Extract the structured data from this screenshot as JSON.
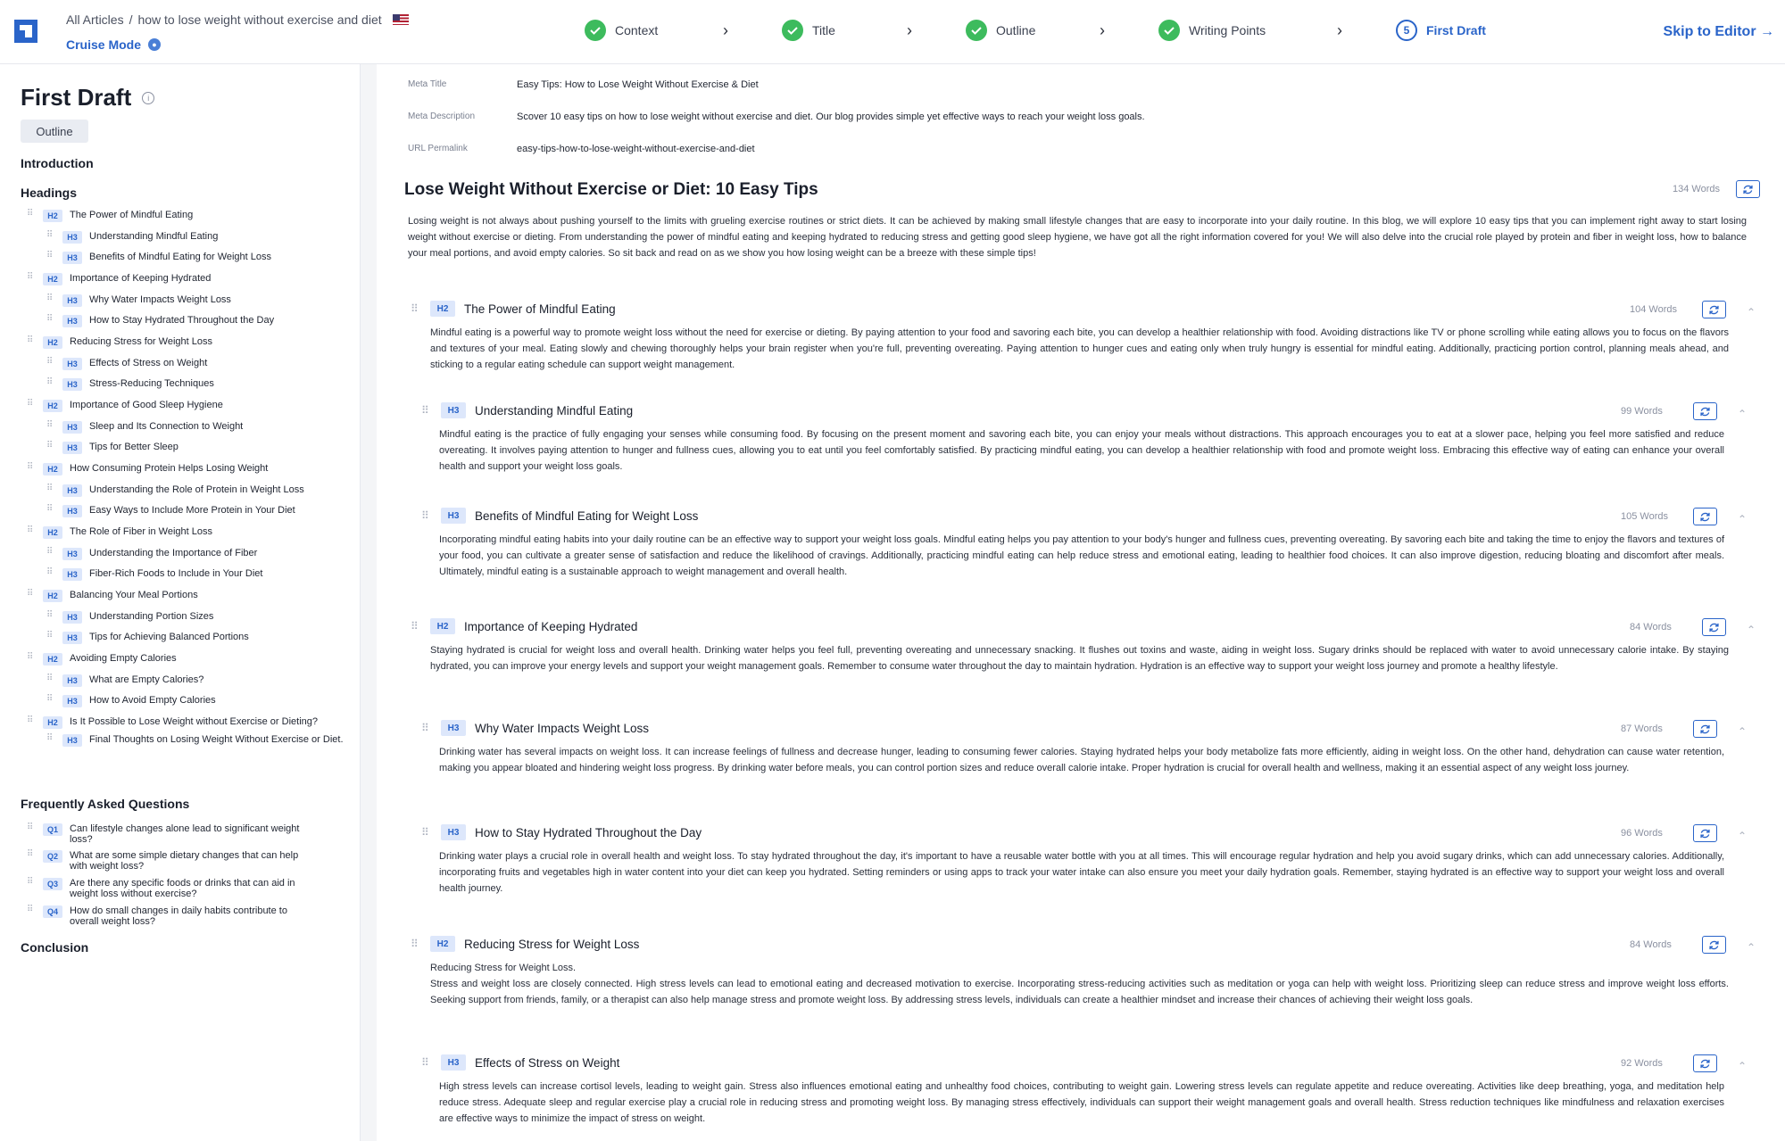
{
  "breadcrumb": {
    "root": "All Articles",
    "separator": "/",
    "current": "how to lose weight without exercise and diet"
  },
  "cruise_mode": "Cruise Mode",
  "steps": [
    {
      "label": "Context",
      "state": "done"
    },
    {
      "label": "Title",
      "state": "done"
    },
    {
      "label": "Outline",
      "state": "done"
    },
    {
      "label": "Writing Points",
      "state": "done"
    },
    {
      "label": "First Draft",
      "state": "active",
      "number": "5"
    }
  ],
  "skip_label": "Skip to Editor →",
  "sidebar": {
    "title": "First Draft",
    "outline_button": "Outline",
    "introduction": "Introduction",
    "headings_label": "Headings",
    "headings": [
      {
        "tag": "H2",
        "text": "The Power of Mindful Eating"
      },
      {
        "tag": "H3",
        "text": "Understanding Mindful Eating"
      },
      {
        "tag": "H3",
        "text": "Benefits of Mindful Eating for Weight Loss"
      },
      {
        "tag": "H2",
        "text": "Importance of Keeping Hydrated"
      },
      {
        "tag": "H3",
        "text": "Why Water Impacts Weight Loss"
      },
      {
        "tag": "H3",
        "text": "How to Stay Hydrated Throughout the Day"
      },
      {
        "tag": "H2",
        "text": "Reducing Stress for Weight Loss"
      },
      {
        "tag": "H3",
        "text": "Effects of Stress on Weight"
      },
      {
        "tag": "H3",
        "text": "Stress-Reducing Techniques"
      },
      {
        "tag": "H2",
        "text": "Importance of Good Sleep Hygiene"
      },
      {
        "tag": "H3",
        "text": "Sleep and Its Connection to Weight"
      },
      {
        "tag": "H3",
        "text": "Tips for Better Sleep"
      },
      {
        "tag": "H2",
        "text": "How Consuming Protein Helps Losing Weight"
      },
      {
        "tag": "H3",
        "text": "Understanding the Role of Protein in Weight Loss"
      },
      {
        "tag": "H3",
        "text": "Easy Ways to Include More Protein in Your Diet"
      },
      {
        "tag": "H2",
        "text": "The Role of Fiber in Weight Loss"
      },
      {
        "tag": "H3",
        "text": "Understanding the Importance of Fiber"
      },
      {
        "tag": "H3",
        "text": "Fiber-Rich Foods to Include in Your Diet"
      },
      {
        "tag": "H2",
        "text": "Balancing Your Meal Portions"
      },
      {
        "tag": "H3",
        "text": "Understanding Portion Sizes"
      },
      {
        "tag": "H3",
        "text": "Tips for Achieving Balanced Portions"
      },
      {
        "tag": "H2",
        "text": "Avoiding Empty Calories"
      },
      {
        "tag": "H3",
        "text": "What are Empty Calories?"
      },
      {
        "tag": "H3",
        "text": "How to Avoid Empty Calories"
      },
      {
        "tag": "H2",
        "text": "Is It Possible to Lose Weight without Exercise or Dieting?"
      },
      {
        "tag": "H3",
        "text": "Final Thoughts on Losing Weight Without Exercise or Diet."
      }
    ],
    "faq_label": "Frequently Asked Questions",
    "faqs": [
      {
        "tag": "Q1",
        "text": "Can lifestyle changes alone lead to significant weight loss?"
      },
      {
        "tag": "Q2",
        "text": "What are some simple dietary changes that can help with weight loss?"
      },
      {
        "tag": "Q3",
        "text": "Are there any specific foods or drinks that can aid in weight loss without exercise?"
      },
      {
        "tag": "Q4",
        "text": "How do small changes in daily habits contribute to overall weight loss?"
      }
    ],
    "conclusion": "Conclusion"
  },
  "meta": {
    "title_label": "Meta Title",
    "title_value": "Easy Tips: How to Lose Weight Without Exercise & Diet",
    "desc_label": "Meta Description",
    "desc_value": "Scover 10 easy tips on how to lose weight without exercise and diet. Our blog provides simple yet effective ways to reach your weight loss goals.",
    "url_label": "URL Permalink",
    "url_value": "easy-tips-how-to-lose-weight-without-exercise-and-diet"
  },
  "article": {
    "title": "Lose Weight Without Exercise or Diet: 10 Easy Tips",
    "words": "134 Words",
    "intro": "Losing weight is not always about pushing yourself to the limits with grueling exercise routines or strict diets. It can be achieved by making small lifestyle changes that are easy to incorporate into your daily routine. In this blog, we will explore 10 easy tips that you can implement right away to start losing weight without exercise or dieting. From understanding the power of mindful eating and keeping hydrated to reducing stress and getting good sleep hygiene, we have got all the right information covered for you! We will also delve into the crucial role played by protein and fiber in weight loss, how to balance your meal portions, and avoid empty calories. So sit back and read on as we show you how losing weight can be a breeze with these simple tips!",
    "sections": [
      {
        "tag": "H2",
        "title": "The Power of Mindful Eating",
        "words": "104 Words",
        "text": "Mindful eating is a powerful way to promote weight loss without the need for exercise or dieting. By paying attention to your food and savoring each bite, you can develop a healthier relationship with food. Avoiding distractions like TV or phone scrolling while eating allows you to focus on the flavors and textures of your meal. Eating slowly and chewing thoroughly helps your brain register when you're full, preventing overeating. Paying attention to hunger cues and eating only when truly hungry is essential for mindful eating. Additionally, practicing portion control, planning meals ahead, and sticking to a regular eating schedule can support weight management."
      },
      {
        "tag": "H3",
        "title": "Understanding Mindful Eating",
        "words": "99 Words",
        "text": "Mindful eating is the practice of fully engaging your senses while consuming food. By focusing on the present moment and savoring each bite, you can enjoy your meals without distractions. This approach encourages you to eat at a slower pace, helping you feel more satisfied and reduce overeating. It involves paying attention to hunger and fullness cues, allowing you to eat until you feel comfortably satisfied. By practicing mindful eating, you can develop a healthier relationship with food and promote weight loss. Embracing this effective way of eating can enhance your overall health and support your weight loss goals."
      },
      {
        "tag": "H3",
        "title": "Benefits of Mindful Eating for Weight Loss",
        "words": "105 Words",
        "text": "Incorporating mindful eating habits into your daily routine can be an effective way to support your weight loss goals. Mindful eating helps you pay attention to your body's hunger and fullness cues, preventing overeating. By savoring each bite and taking the time to enjoy the flavors and textures of your food, you can cultivate a greater sense of satisfaction and reduce the likelihood of cravings. Additionally, practicing mindful eating can help reduce stress and emotional eating, leading to healthier food choices. It can also improve digestion, reducing bloating and discomfort after meals. Ultimately, mindful eating is a sustainable approach to weight management and overall health."
      },
      {
        "tag": "H2",
        "title": "Importance of Keeping Hydrated",
        "words": "84 Words",
        "text": "Staying hydrated is crucial for weight loss and overall health. Drinking water helps you feel full, preventing overeating and unnecessary snacking. It flushes out toxins and waste, aiding in weight loss. Sugary drinks should be replaced with water to avoid unnecessary calorie intake. By staying hydrated, you can improve your energy levels and support your weight management goals. Remember to consume water throughout the day to maintain hydration. Hydration is an effective way to support your weight loss journey and promote a healthy lifestyle."
      },
      {
        "tag": "H3",
        "title": "Why Water Impacts Weight Loss",
        "words": "87 Words",
        "text": "Drinking water has several impacts on weight loss. It can increase feelings of fullness and decrease hunger, leading to consuming fewer calories. Staying hydrated helps your body metabolize fats more efficiently, aiding in weight loss. On the other hand, dehydration can cause water retention, making you appear bloated and hindering weight loss progress. By drinking water before meals, you can control portion sizes and reduce overall calorie intake. Proper hydration is crucial for overall health and wellness, making it an essential aspect of any weight loss journey."
      },
      {
        "tag": "H3",
        "title": "How to Stay Hydrated Throughout the Day",
        "words": "96 Words",
        "text": "Drinking water plays a crucial role in overall health and weight loss. To stay hydrated throughout the day, it's important to have a reusable water bottle with you at all times. This will encourage regular hydration and help you avoid sugary drinks, which can add unnecessary calories. Additionally, incorporating fruits and vegetables high in water content into your diet can keep you hydrated. Setting reminders or using apps to track your water intake can also ensure you meet your daily hydration goals. Remember, staying hydrated is an effective way to support your weight loss and overall health journey."
      },
      {
        "tag": "H2",
        "title": "Reducing Stress for Weight Loss",
        "words": "84 Words",
        "text": "Reducing Stress for Weight Loss.\nStress and weight loss are closely connected. High stress levels can lead to emotional eating and decreased motivation to exercise. Incorporating stress-reducing activities such as meditation or yoga can help with weight loss. Prioritizing sleep can reduce stress and improve weight loss efforts. Seeking support from friends, family, or a therapist can also help manage stress and promote weight loss. By addressing stress levels, individuals can create a healthier mindset and increase their chances of achieving their weight loss goals."
      },
      {
        "tag": "H3",
        "title": "Effects of Stress on Weight",
        "words": "92 Words",
        "text": "High stress levels can increase cortisol levels, leading to weight gain. Stress also influences emotional eating and unhealthy food choices, contributing to weight gain. Lowering stress levels can regulate appetite and reduce overeating. Activities like deep breathing, yoga, and meditation help reduce stress. Adequate sleep and regular exercise play a crucial role in reducing stress and promoting weight loss. By managing stress effectively, individuals can support their weight management goals and overall health. Stress reduction techniques like mindfulness and relaxation exercises are effective ways to minimize the impact of stress on weight."
      }
    ]
  }
}
